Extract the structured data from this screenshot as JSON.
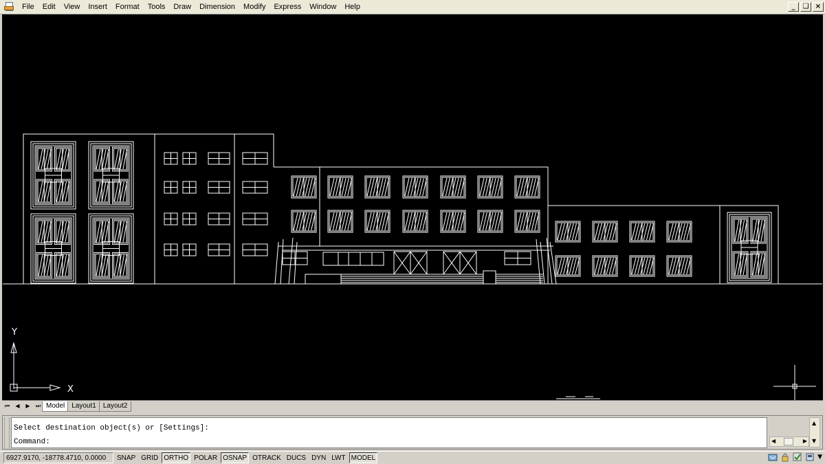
{
  "menubar": {
    "items": [
      "File",
      "Edit",
      "View",
      "Insert",
      "Format",
      "Tools",
      "Draw",
      "Dimension",
      "Modify",
      "Express",
      "Window",
      "Help"
    ],
    "controls": [
      "_",
      "❏",
      "×"
    ]
  },
  "viewport": {
    "background": "#000000",
    "line_color": "#ffffff",
    "ucs": {
      "x_label": "X",
      "y_label": "Y"
    }
  },
  "layout_tabs": {
    "nav": [
      "⏮",
      "◀",
      "▶",
      "⏭"
    ],
    "tabs": [
      "Model",
      "Layout1",
      "Layout2"
    ],
    "active": "Model"
  },
  "command": {
    "line1": "Select destination object(s) or [Settings]:",
    "line2": "Command:"
  },
  "status": {
    "coords": "6927.9170, -18778.4710, 0.0000",
    "toggles": [
      {
        "label": "SNAP",
        "on": false
      },
      {
        "label": "GRID",
        "on": false
      },
      {
        "label": "ORTHO",
        "on": true
      },
      {
        "label": "POLAR",
        "on": false
      },
      {
        "label": "OSNAP",
        "on": true
      },
      {
        "label": "OTRACK",
        "on": false
      },
      {
        "label": "DUCS",
        "on": false
      },
      {
        "label": "DYN",
        "on": false
      },
      {
        "label": "LWT",
        "on": false
      },
      {
        "label": "MODEL",
        "on": true
      }
    ]
  }
}
